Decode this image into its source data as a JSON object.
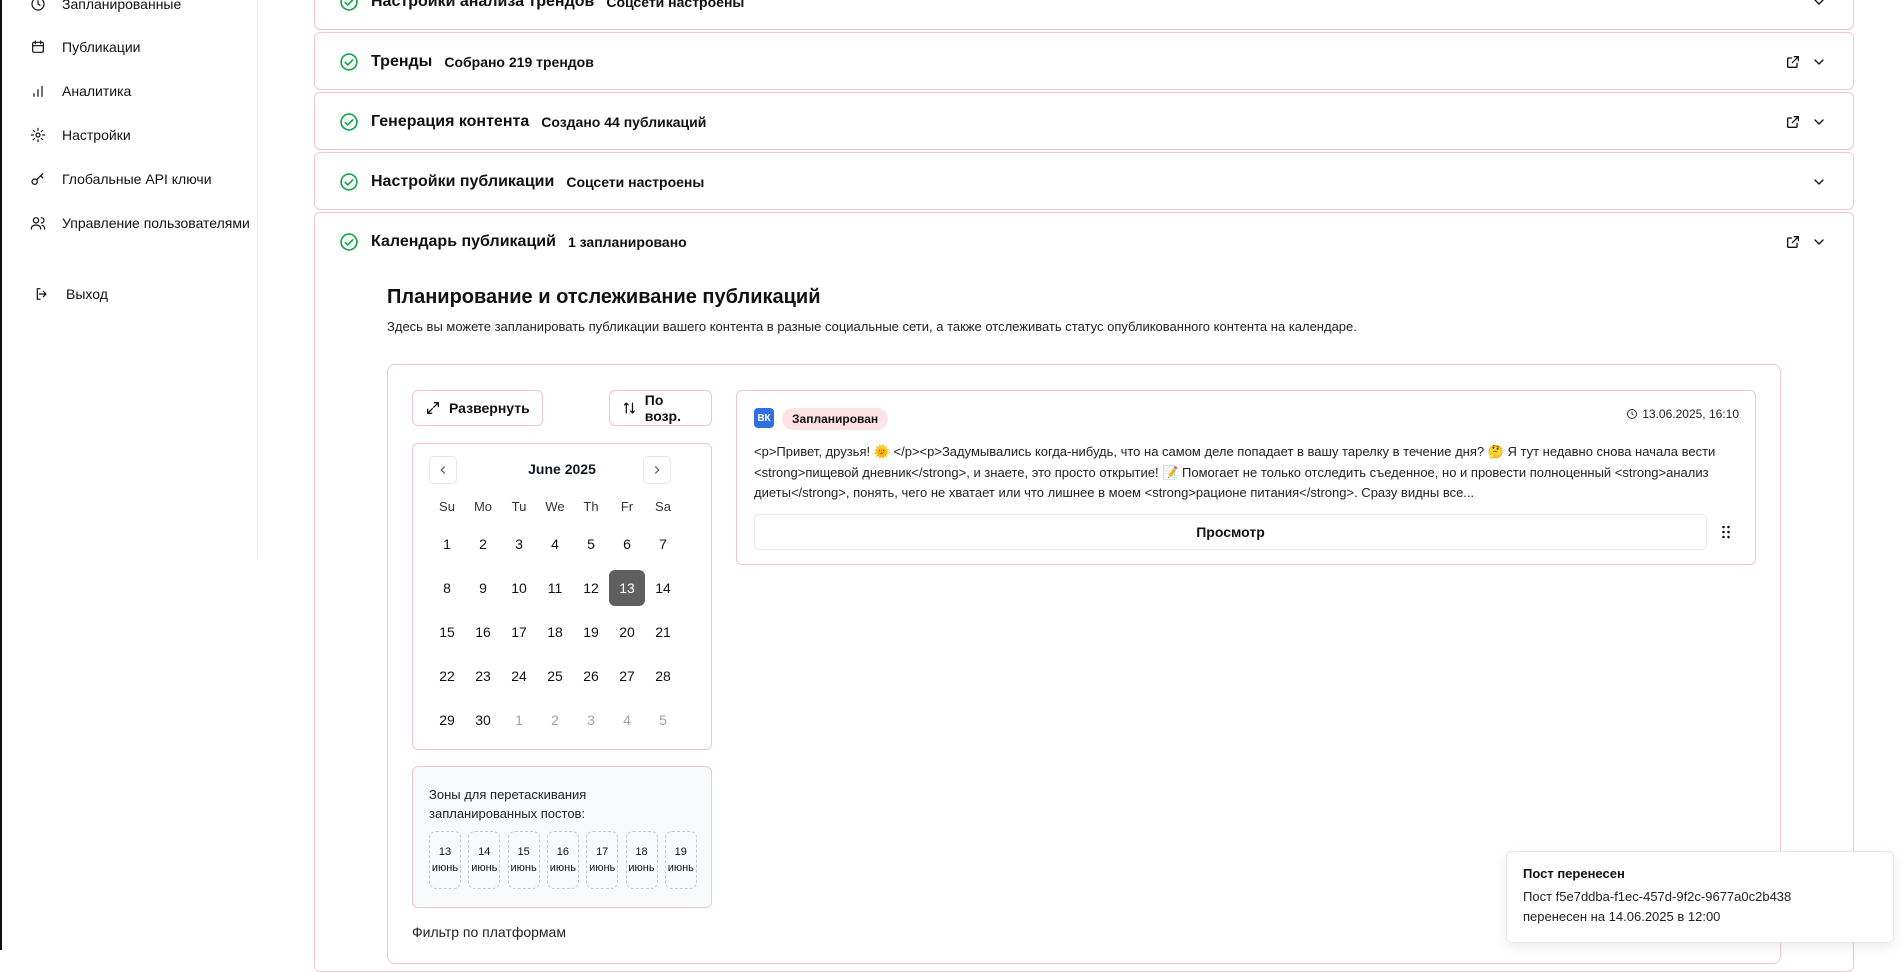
{
  "sidebar": {
    "items": [
      {
        "label": "Запланированные",
        "icon": "clock-icon"
      },
      {
        "label": "Публикации",
        "icon": "calendar-icon"
      },
      {
        "label": "Аналитика",
        "icon": "bar-chart-icon"
      },
      {
        "label": "Настройки",
        "icon": "gear-icon"
      },
      {
        "label": "Глобальные API ключи",
        "icon": "key-icon"
      },
      {
        "label": "Управление пользователями",
        "icon": "users-icon"
      }
    ],
    "logout": {
      "label": "Выход",
      "icon": "logout-icon"
    }
  },
  "accordion": [
    {
      "title": "Настройки анализа трендов",
      "subtitle": "Соцсети настроены",
      "status": "done"
    },
    {
      "title": "Тренды",
      "subtitle": "Собрано 219 трендов",
      "status": "done"
    },
    {
      "title": "Генерация контента",
      "subtitle": "Создано 44 публикаций",
      "status": "done"
    },
    {
      "title": "Настройки публикации",
      "subtitle": "Соцсети настроены",
      "status": "done"
    },
    {
      "title": "Календарь публикаций",
      "subtitle": "1 запланировано",
      "status": "done"
    }
  ],
  "scheduler": {
    "title": "Планирование и отслеживание публикаций",
    "description": "Здесь вы можете запланировать публикации вашего контента в разные социальные сети, а также отслеживать статус опубликованного контента на календаре.",
    "expand_label": "Развернуть",
    "sort_label": "По возр.",
    "filter_label": "Фильтр по платформам"
  },
  "calendar": {
    "month": "June 2025",
    "weekdays": [
      "Su",
      "Mo",
      "Tu",
      "We",
      "Th",
      "Fr",
      "Sa"
    ],
    "selected_day": "13",
    "days": [
      "1",
      "2",
      "3",
      "4",
      "5",
      "6",
      "7",
      "8",
      "9",
      "10",
      "11",
      "12",
      "13",
      "14",
      "15",
      "16",
      "17",
      "18",
      "19",
      "20",
      "21",
      "22",
      "23",
      "24",
      "25",
      "26",
      "27",
      "28",
      "29",
      "30",
      "1",
      "2",
      "3",
      "4",
      "5"
    ]
  },
  "drop_zones": {
    "label": "Зоны для перетаскивания запланированных постов:",
    "zones": [
      {
        "day": "13",
        "month": "июнь"
      },
      {
        "day": "14",
        "month": "июнь"
      },
      {
        "day": "15",
        "month": "июнь"
      },
      {
        "day": "16",
        "month": "июнь"
      },
      {
        "day": "17",
        "month": "июнь"
      },
      {
        "day": "18",
        "month": "июнь"
      },
      {
        "day": "19",
        "month": "июнь"
      }
    ]
  },
  "post": {
    "platform": "ВК",
    "status": "Запланирован",
    "datetime": "13.06.2025, 16:10",
    "text": "<p>Привет, друзья! 🌞 </p><p>Задумывались когда-нибудь, что на самом деле попадает в вашу тарелку в течение дня? 🤔 Я тут недавно снова начала вести <strong>пищевой дневник</strong>, и знаете, это просто открытие! 📝 Помогает не только отследить съеденное, но и провести полноценный <strong>анализ диеты</strong>, понять, чего не хватает или что лишнее в моем <strong>рационе питания</strong>. Сразу видны все...",
    "view_label": "Просмотр"
  },
  "toast": {
    "title": "Пост перенесен",
    "line1": "Пост f5e7ddba-f1ec-457d-9f2c-9677a0c2b438",
    "line2": "перенесен на 14.06.2025 в 12:00"
  },
  "colors": {
    "accent_border": "#f3c6cf",
    "check_green": "#16a34a",
    "selected_day": "#5f5f5f",
    "status_pill": "#fde2e7",
    "vk_blue": "#2f6fe0"
  }
}
